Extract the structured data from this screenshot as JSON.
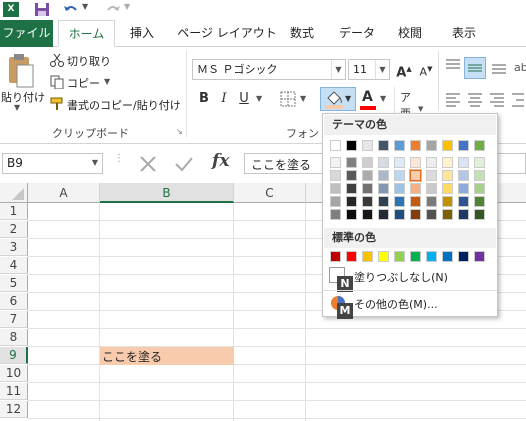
{
  "titlebar": {
    "app_icon": "excel-icon"
  },
  "tabs": [
    {
      "label": "ファイル"
    },
    {
      "label": "ホーム"
    },
    {
      "label": "挿入"
    },
    {
      "label": "ページ レイアウト"
    },
    {
      "label": "数式"
    },
    {
      "label": "データ"
    },
    {
      "label": "校閲"
    },
    {
      "label": "表示"
    }
  ],
  "clipboard": {
    "paste_label": "貼り付け",
    "cut_label": "切り取り",
    "copy_label": "コピー",
    "format_painter_label": "書式のコピー/貼り付け",
    "group_label": "クリップボード"
  },
  "font": {
    "name": "ＭＳ Ｐゴシック",
    "size": "11",
    "group_label": "フォント",
    "bold": "B",
    "italic": "I",
    "underline": "U",
    "grow": "A",
    "shrink": "A",
    "font_color_letter": "A"
  },
  "formula_bar": {
    "name_box": "B9",
    "fx": "fx",
    "content": "ここを塗る"
  },
  "grid": {
    "columns": [
      "A",
      "B",
      "C"
    ],
    "rows": [
      "1",
      "2",
      "3",
      "4",
      "5",
      "6",
      "7",
      "8",
      "9",
      "10",
      "11",
      "12"
    ],
    "cell_b9": "ここを塗る",
    "highlight_color": "#f8cbad"
  },
  "palette": {
    "theme_title": "テーマの色",
    "standard_title": "標準の色",
    "no_fill_label": "塗りつぶしなし(N)",
    "more_colors_label": "その他の色(M)...",
    "badge_n": "N",
    "badge_m": "M",
    "theme_top": [
      "#ffffff",
      "#000000",
      "#e7e6e6",
      "#44546a",
      "#5b9bd5",
      "#ed7d31",
      "#a5a5a5",
      "#ffc000",
      "#4472c4",
      "#70ad47"
    ],
    "theme_shades": [
      [
        "#f2f2f2",
        "#808080",
        "#d0cece",
        "#d6dce4",
        "#deebf6",
        "#fbe5d5",
        "#ededed",
        "#fff2cc",
        "#dae3f3",
        "#e2efd9"
      ],
      [
        "#d8d8d8",
        "#595959",
        "#aeabab",
        "#adb9ca",
        "#bdd7ee",
        "#f8cbad",
        "#dbdbdb",
        "#fee599",
        "#b4c6e7",
        "#c5e0b3"
      ],
      [
        "#bfbfbf",
        "#3f3f3f",
        "#757070",
        "#8496b0",
        "#9cc3e5",
        "#f4b183",
        "#c9c9c9",
        "#ffd965",
        "#8eaadb",
        "#a8d08d"
      ],
      [
        "#a5a5a5",
        "#262626",
        "#3a3838",
        "#323f4f",
        "#2e75b5",
        "#c55a11",
        "#7b7b7b",
        "#bf9000",
        "#2f5496",
        "#538135"
      ],
      [
        "#7f7f7f",
        "#0c0c0c",
        "#171616",
        "#222a35",
        "#1e4e79",
        "#843c0b",
        "#525252",
        "#7f6000",
        "#1f3864",
        "#375623"
      ]
    ],
    "standard": [
      "#c00000",
      "#ff0000",
      "#ffc000",
      "#ffff00",
      "#92d050",
      "#00b050",
      "#00b0f0",
      "#0070c0",
      "#002060",
      "#7030a0"
    ],
    "selected_color": "#f8cbad"
  }
}
